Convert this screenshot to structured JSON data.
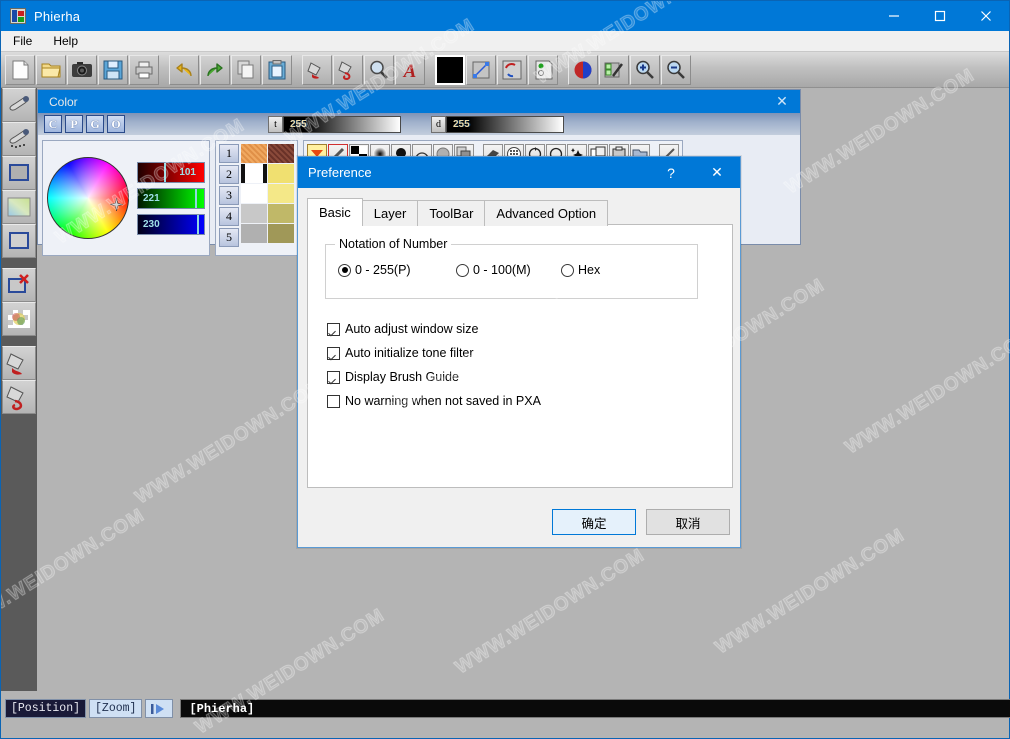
{
  "window": {
    "title": "Phierha",
    "icon": "app-icon",
    "controls": {
      "minimize": "–",
      "maximize": "□",
      "close": "✕"
    }
  },
  "menubar": {
    "items": [
      {
        "label": "File"
      },
      {
        "label": "Help"
      }
    ]
  },
  "toolbar": {
    "groups": [
      {
        "buttons": [
          {
            "name": "new-file-icon",
            "title": "New"
          },
          {
            "name": "open-folder-icon",
            "title": "Open"
          },
          {
            "name": "camera-icon",
            "title": "Capture"
          },
          {
            "name": "save-floppy-icon",
            "title": "Save"
          },
          {
            "name": "printer-icon",
            "title": "Print"
          }
        ]
      },
      {
        "buttons": [
          {
            "name": "undo-arrow-icon",
            "title": "Undo"
          },
          {
            "name": "redo-arrow-icon",
            "title": "Redo"
          },
          {
            "name": "copy-icon",
            "title": "Copy"
          },
          {
            "name": "paste-clipboard-icon",
            "title": "Paste"
          }
        ]
      },
      {
        "buttons": [
          {
            "name": "paint-bucket-icon",
            "title": "Fill"
          },
          {
            "name": "paint-bucket-curve-icon",
            "title": "Fill Curve"
          },
          {
            "name": "magnifier-icon",
            "title": "Magnify"
          },
          {
            "name": "text-tool-icon",
            "title": "Text"
          }
        ]
      },
      {
        "buttons": [
          {
            "name": "color-swatch-black",
            "title": "Color"
          },
          {
            "name": "transform-node-icon",
            "title": "Transform"
          },
          {
            "name": "rotate-flip-icon",
            "title": "Rotate"
          },
          {
            "name": "layer-node-icon",
            "title": "Node"
          }
        ]
      },
      {
        "buttons": [
          {
            "name": "sphere-shading-icon",
            "title": "Shade"
          },
          {
            "name": "pen-edit-icon",
            "title": "Edit"
          },
          {
            "name": "zoom-in-icon",
            "title": "Zoom In"
          },
          {
            "name": "zoom-out-icon",
            "title": "Zoom Out"
          }
        ]
      }
    ]
  },
  "sidebar": {
    "items": [
      {
        "name": "sidebar-pen-tool",
        "title": "Pen"
      },
      {
        "name": "sidebar-dotted-pen-tool",
        "title": "Dotted Pen"
      },
      {
        "name": "sidebar-rect-tool",
        "title": "Rectangle"
      },
      {
        "name": "sidebar-gradient-tool",
        "title": "Gradient"
      },
      {
        "name": "sidebar-rect-outline-tool",
        "title": "Rectangle Outline"
      },
      {
        "name": "sidebar-delete-selection-tool",
        "title": "Delete Selection"
      },
      {
        "name": "sidebar-transparency-tool",
        "title": "Transparency"
      },
      {
        "name": "sidebar-bucket-tool",
        "title": "Bucket"
      },
      {
        "name": "sidebar-bucket-curve-tool",
        "title": "Bucket Curve"
      }
    ]
  },
  "color_window": {
    "title": "Color",
    "close_label": "✕",
    "mode_buttons": [
      {
        "label": "C",
        "name": "color-mode-c"
      },
      {
        "label": "P",
        "name": "color-mode-p"
      },
      {
        "label": "G",
        "name": "color-mode-g"
      },
      {
        "label": "O",
        "name": "color-mode-o"
      }
    ],
    "sliders": [
      {
        "tab": "t",
        "value": "255",
        "name": "tone-slider"
      },
      {
        "tab": "d",
        "value": "255",
        "name": "density-slider"
      }
    ],
    "rgb": {
      "red": {
        "value": "101",
        "percent": 40
      },
      "green": {
        "value": "221",
        "percent": 87
      },
      "blue": {
        "value": "230",
        "percent": 90
      }
    },
    "layers": [
      {
        "number": "1"
      },
      {
        "number": "2"
      },
      {
        "number": "3"
      },
      {
        "number": "4"
      },
      {
        "number": "5"
      }
    ],
    "brush_tools": [
      {
        "name": "gradient-triangle-icon"
      },
      {
        "name": "pencil-icon"
      },
      {
        "name": "checker-icon"
      },
      {
        "name": "soft-dot-icon"
      },
      {
        "name": "blob-icon"
      },
      {
        "name": "arc-icon"
      },
      {
        "name": "circle-icon"
      },
      {
        "name": "layers-icon"
      },
      {
        "name": "eraser-icon"
      },
      {
        "name": "halftone-icon"
      },
      {
        "name": "rotate-left-icon"
      },
      {
        "name": "rotate-right-icon"
      },
      {
        "name": "sparkle-icon"
      },
      {
        "name": "duplicate-icon"
      },
      {
        "name": "clipboard-icon"
      },
      {
        "name": "folder-icon"
      },
      {
        "name": "brush-icon"
      }
    ]
  },
  "preference": {
    "title": "Preference",
    "help_label": "?",
    "close_label": "✕",
    "tabs": [
      {
        "label": "Basic",
        "active": true
      },
      {
        "label": "Layer",
        "active": false
      },
      {
        "label": "ToolBar",
        "active": false
      },
      {
        "label": "Advanced Option",
        "active": false
      }
    ],
    "notation": {
      "legend": "Notation of Number",
      "options": [
        {
          "label": "0 - 255(P)",
          "selected": true
        },
        {
          "label": "0 - 100(M)",
          "selected": false
        },
        {
          "label": "Hex",
          "selected": false
        }
      ]
    },
    "checkboxes": [
      {
        "label": "Auto adjust window size",
        "checked": true
      },
      {
        "label": "Auto initialize tone filter",
        "checked": true
      },
      {
        "label": "Display Brush Guide",
        "checked": true
      },
      {
        "label": "No warning when not saved in PXA",
        "checked": false
      }
    ],
    "buttons": {
      "ok": "确定",
      "cancel": "取消"
    }
  },
  "statusbar": {
    "position_label": "[Position]",
    "zoom_label": "[Zoom]",
    "play_icon": "play-icon",
    "document_label": "[Phierha]"
  },
  "watermark": {
    "text": "WWW.WEIDOWN.COM"
  },
  "colors": {
    "accent": "#0078d7",
    "window_bg": "#b4b4b4",
    "dialog_bg": "#f0f0f0",
    "panel_bg": "#eef1f7"
  }
}
